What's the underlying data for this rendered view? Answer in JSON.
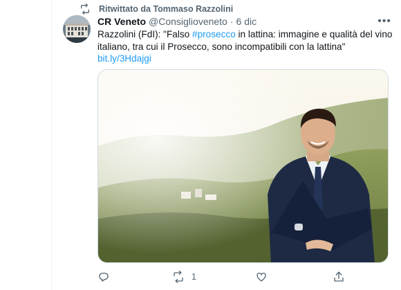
{
  "retweet_banner": {
    "text": "Ritwittato da Tommaso Razzolini",
    "icon": "retweet-icon"
  },
  "tweet": {
    "author_name": "CR Veneto",
    "handle": "@Consiglioveneto",
    "separator": "·",
    "date": "6 dic",
    "more_icon": "more-icon",
    "text_before": "Razzolini (FdI): \"Falso ",
    "hashtag": "#prosecco",
    "text_after": " in lattina: immagine e qualità del vino italiano, tra cui il Prosecco, sono incompatibili con la lattina\"",
    "link": "bit.ly/3Hdajgi"
  },
  "actions": {
    "reply": {
      "icon": "reply-icon",
      "count": ""
    },
    "retweet": {
      "icon": "retweet-icon",
      "count": "1"
    },
    "like": {
      "icon": "heart-icon",
      "count": ""
    },
    "share": {
      "icon": "share-icon",
      "count": ""
    }
  },
  "colors": {
    "accent": "#1d9bf0",
    "secondary_text": "#536471",
    "primary_text": "#0f1419",
    "border": "#cfd9de"
  }
}
